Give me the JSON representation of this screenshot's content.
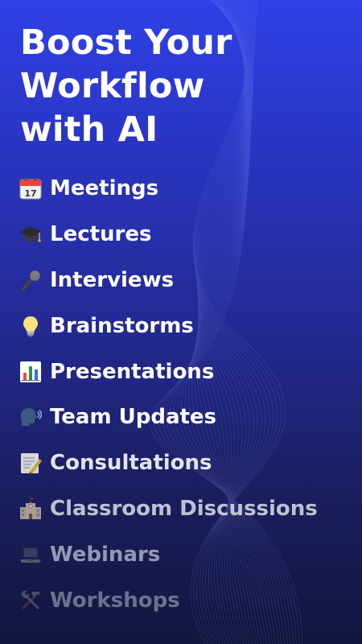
{
  "headline": {
    "line1": "Boost Your",
    "line2": "Workflow",
    "line3": "with AI"
  },
  "use_cases": [
    {
      "label": "Meetings",
      "icon": "calendar-icon",
      "opacity": 1.0
    },
    {
      "label": "Lectures",
      "icon": "graduation-cap-icon",
      "opacity": 1.0
    },
    {
      "label": "Interviews",
      "icon": "microphone-icon",
      "opacity": 1.0
    },
    {
      "label": "Brainstorms",
      "icon": "light-bulb-icon",
      "opacity": 1.0
    },
    {
      "label": "Presentations",
      "icon": "bar-chart-icon",
      "opacity": 1.0
    },
    {
      "label": "Team Updates",
      "icon": "speaking-head-icon",
      "opacity": 1.0
    },
    {
      "label": "Consultations",
      "icon": "memo-icon",
      "opacity": 0.88
    },
    {
      "label": "Classroom Discussions",
      "icon": "school-icon",
      "opacity": 0.72
    },
    {
      "label": "Webinars",
      "icon": "laptop-icon",
      "opacity": 0.55
    },
    {
      "label": "Workshops",
      "icon": "tools-icon",
      "opacity": 0.38
    }
  ],
  "colors": {
    "background_top": "#2f41e6",
    "background_bottom": "#13153e",
    "text": "#ffffff"
  }
}
